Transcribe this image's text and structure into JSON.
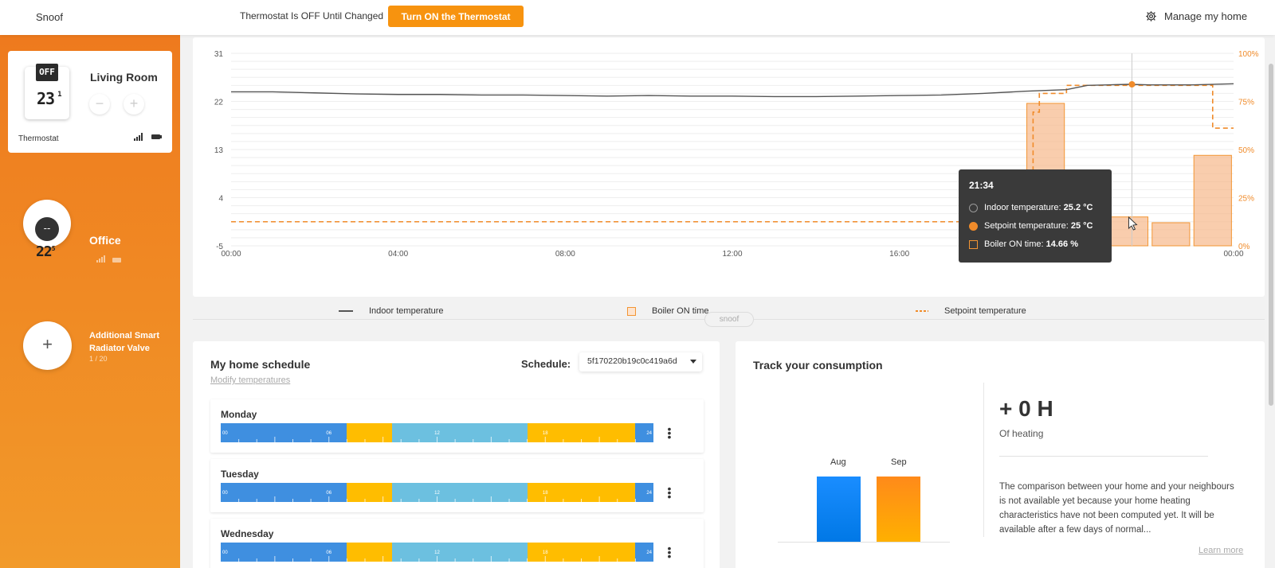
{
  "header": {
    "brand": "Snoof",
    "status": "Thermostat Is OFF Until Changed",
    "turn_on_label": "Turn ON the Thermostat",
    "manage_label": "Manage my home"
  },
  "sidebar": {
    "living_room": {
      "off_label": "OFF",
      "display_temp": "23",
      "display_temp_decimal": "1",
      "name": "Living Room",
      "minus": "−",
      "plus": "+",
      "device_label": "Thermostat"
    },
    "office": {
      "badge": "--",
      "display_temp": "22",
      "display_temp_decimal": "5",
      "name": "Office"
    },
    "add_valve": {
      "plus": "+",
      "label": "Additional Smart Radiator Valve",
      "count": "1 / 20"
    }
  },
  "chart_data": {
    "type": "line",
    "x_ticks": [
      "00:00",
      "04:00",
      "08:00",
      "12:00",
      "16:00",
      "00:00"
    ],
    "y_left_ticks": [
      "31",
      "22",
      "13",
      "4",
      "-5"
    ],
    "y_right_ticks": [
      "100%",
      "75%",
      "50%",
      "25%",
      "0%"
    ],
    "ylim_left": [
      -5,
      31
    ],
    "ylim_right": [
      0,
      100
    ],
    "series": [
      {
        "name": "Indoor temperature",
        "x_hours": [
          0,
          1,
          2,
          3,
          4,
          5,
          6,
          7,
          8,
          9,
          10,
          11,
          12,
          13,
          14,
          15,
          16,
          17,
          18,
          19,
          20,
          20.5,
          21,
          21.5,
          22,
          23,
          24
        ],
        "values": [
          23.8,
          23.8,
          23.6,
          23.4,
          23.3,
          23.3,
          23.2,
          23.2,
          23.1,
          23.0,
          23.1,
          23.0,
          23.0,
          22.9,
          22.9,
          23.0,
          23.1,
          23.2,
          23.5,
          23.9,
          24.2,
          25.0,
          25.1,
          25.2,
          25.1,
          25.1,
          25.3
        ]
      },
      {
        "name": "Setpoint temperature",
        "x_hours": [
          0,
          19.2,
          19.2,
          19.35,
          19.35,
          20.0,
          20.0,
          21.0,
          21.0,
          23.5,
          23.5,
          24
        ],
        "values": [
          0,
          0,
          20,
          20,
          23.5,
          23.5,
          25,
          25,
          25,
          25,
          17,
          17
        ]
      },
      {
        "name": "Boiler ON time",
        "type": "bar",
        "x_hours": [
          19.5,
          20.5,
          21.5,
          22.5,
          23.5
        ],
        "values": [
          74,
          37,
          15,
          12,
          47
        ]
      }
    ],
    "tooltip": {
      "time": "21:34",
      "indoor_label": "Indoor temperature: ",
      "indoor_value": "25.2 °C",
      "setpoint_label": "Setpoint temperature: ",
      "setpoint_value": "25 °C",
      "boiler_label": "Boiler ON time: ",
      "boiler_value": "14.66 %"
    },
    "colors": {
      "indoor": "#555555",
      "setpoint": "#f08b2a",
      "boiler": "#f6b88a"
    }
  },
  "divider_label": "snoof",
  "schedule": {
    "title": "My home schedule",
    "modify_link": "Modify temperatures",
    "schedule_label": "Schedule:",
    "selected_id": "5f170220b19c0c419a6d",
    "tick_labels": [
      "00",
      "06",
      "12",
      "18",
      "24"
    ],
    "segment_colors": [
      "#3f8fe0",
      "#ffbd00",
      "#6cc0e0",
      "#ffbd00",
      "#3f8fe0"
    ],
    "segment_hours": [
      [
        0,
        7
      ],
      [
        7,
        9.5
      ],
      [
        9.5,
        17
      ],
      [
        17,
        23
      ],
      [
        23,
        24
      ]
    ],
    "days": [
      {
        "name": "Monday"
      },
      {
        "name": "Tuesday"
      },
      {
        "name": "Wednesday"
      }
    ]
  },
  "consumption": {
    "title": "Track your consumption",
    "aug_label": "Aug",
    "sep_label": "Sep",
    "heating_value": "+ 0 H",
    "heating_sub": "Of heating",
    "description": "The comparison between your home and your neighbours is not available yet because your home heating characteristics have not been computed yet. It will be available after a few days of normal...",
    "learn_more": "Learn more"
  }
}
